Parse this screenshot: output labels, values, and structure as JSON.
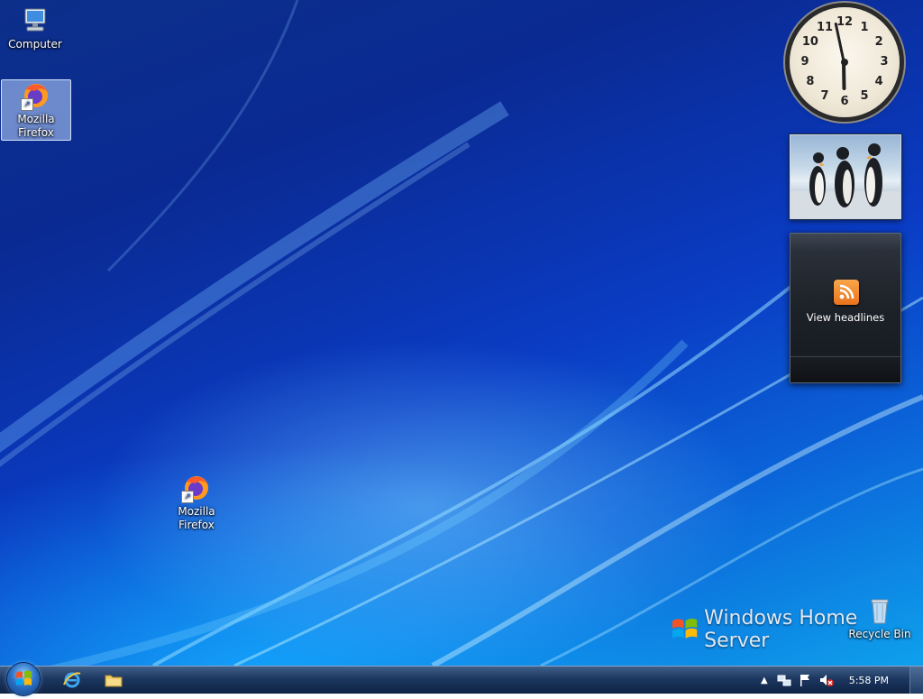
{
  "desktop": {
    "icons": [
      {
        "label": "Computer"
      },
      {
        "label": "Mozilla Firefox"
      },
      {
        "label": "Mozilla Firefox"
      },
      {
        "label": "Recycle Bin"
      }
    ],
    "branding": "Windows Home Server"
  },
  "gadgets": {
    "clock": {
      "numbers": [
        "12",
        "1",
        "2",
        "3",
        "4",
        "5",
        "6",
        "7",
        "8",
        "9",
        "10",
        "11"
      ],
      "time_hours": 5,
      "time_minutes": 58
    },
    "feed": {
      "label": "View headlines"
    }
  },
  "taskbar": {
    "pinned": [
      {
        "icon": "internet-explorer-icon"
      },
      {
        "icon": "windows-explorer-icon"
      }
    ],
    "tray": {
      "icons": [
        "show-hidden-icons-chevron",
        "network-icon",
        "action-center-flag-icon",
        "volume-muted-icon"
      ],
      "time": "5:58 PM"
    }
  },
  "colors": {
    "accent": "#0a3cc4",
    "taskbar": "#1c3760",
    "rss_orange": "#e9731d"
  }
}
